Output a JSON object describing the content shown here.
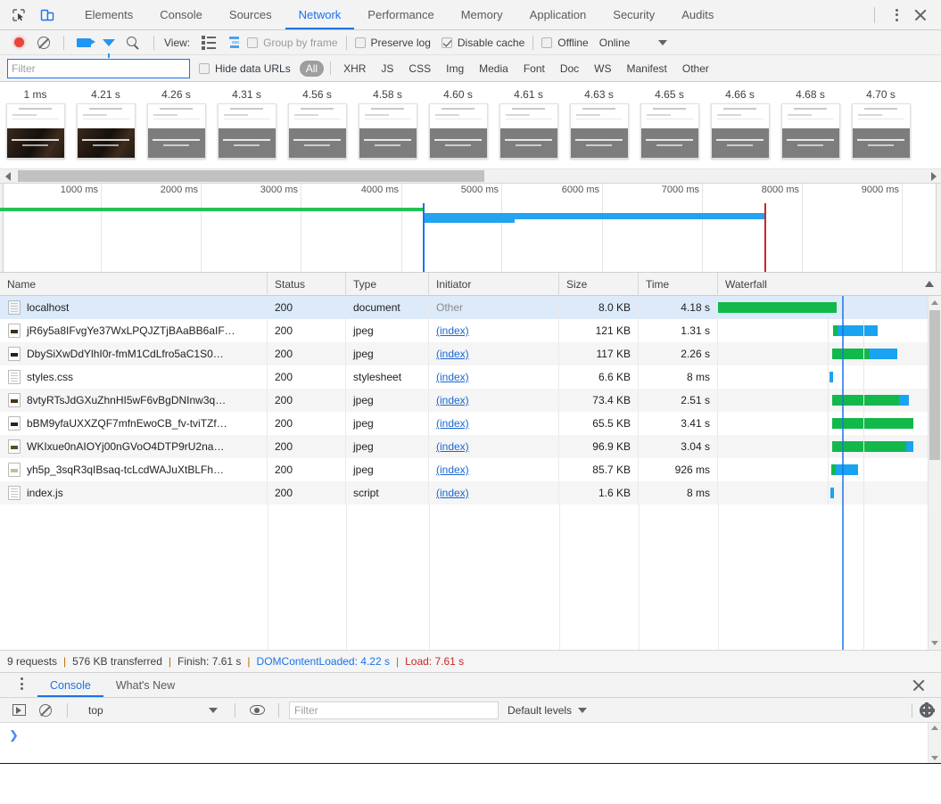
{
  "window": {
    "devtools_tabs": [
      {
        "label": "Elements",
        "active": false
      },
      {
        "label": "Console",
        "active": false
      },
      {
        "label": "Sources",
        "active": false
      },
      {
        "label": "Network",
        "active": true
      },
      {
        "label": "Performance",
        "active": false
      },
      {
        "label": "Memory",
        "active": false
      },
      {
        "label": "Application",
        "active": false
      },
      {
        "label": "Security",
        "active": false
      },
      {
        "label": "Audits",
        "active": false
      }
    ],
    "inspect_icon": "inspect-element-icon",
    "device_icon": "device-toolbar-icon",
    "more_icon": "more-options-icon",
    "close_icon": "close-icon",
    "accent_color": "#1a73e8"
  },
  "network_toolbar": {
    "record_icon": "record-button-icon",
    "clear_icon": "clear-icon",
    "camera_icon": "capture-screenshots-icon",
    "filter_icon": "filter-icon",
    "search_icon": "search-icon",
    "view_label": "View:",
    "view_list_icon": "list-view-icon",
    "view_waterfall_icon": "waterfall-view-icon",
    "group_by_frame": {
      "label": "Group by frame",
      "checked": false,
      "disabled": true
    },
    "preserve_log": {
      "label": "Preserve log",
      "checked": false
    },
    "disable_cache": {
      "label": "Disable cache",
      "checked": true
    },
    "offline": {
      "label": "Offline",
      "checked": false
    },
    "throttling": {
      "label": "Online",
      "caret_icon": "chevron-down-icon"
    }
  },
  "filter_bar": {
    "input_value": "",
    "input_placeholder": "Filter",
    "hide_data_urls": {
      "label": "Hide data URLs",
      "checked": false
    },
    "types": [
      {
        "label": "All",
        "active": true
      },
      {
        "label": "XHR",
        "active": false
      },
      {
        "label": "JS",
        "active": false
      },
      {
        "label": "CSS",
        "active": false
      },
      {
        "label": "Img",
        "active": false
      },
      {
        "label": "Media",
        "active": false
      },
      {
        "label": "Font",
        "active": false
      },
      {
        "label": "Doc",
        "active": false
      },
      {
        "label": "WS",
        "active": false
      },
      {
        "label": "Manifest",
        "active": false
      },
      {
        "label": "Other",
        "active": false
      }
    ]
  },
  "filmstrip": {
    "frames": [
      {
        "time": "1 ms",
        "style": "photo"
      },
      {
        "time": "4.21 s",
        "style": "photo"
      },
      {
        "time": "4.26 s",
        "style": "gray"
      },
      {
        "time": "4.31 s",
        "style": "gray"
      },
      {
        "time": "4.56 s",
        "style": "gray"
      },
      {
        "time": "4.58 s",
        "style": "gray"
      },
      {
        "time": "4.60 s",
        "style": "gray"
      },
      {
        "time": "4.61 s",
        "style": "gray"
      },
      {
        "time": "4.63 s",
        "style": "gray"
      },
      {
        "time": "4.65 s",
        "style": "gray"
      },
      {
        "time": "4.66 s",
        "style": "gray"
      },
      {
        "time": "4.68 s",
        "style": "gray"
      },
      {
        "time": "4.70 s",
        "style": "gray"
      }
    ],
    "scroll_left_icon": "scroll-left-arrow-icon",
    "scroll_right_icon": "scroll-right-arrow-icon"
  },
  "overview": {
    "ticks": [
      "1000 ms",
      "2000 ms",
      "3000 ms",
      "4000 ms",
      "5000 ms",
      "6000 ms",
      "7000 ms",
      "8000 ms",
      "9000 ms"
    ],
    "dom_content_loaded_marker": "4.22 s",
    "load_marker": "7.61 s"
  },
  "table": {
    "columns": [
      {
        "label": "Name"
      },
      {
        "label": "Status"
      },
      {
        "label": "Type"
      },
      {
        "label": "Initiator"
      },
      {
        "label": "Size"
      },
      {
        "label": "Time"
      },
      {
        "label": "Waterfall"
      }
    ],
    "sort_icon": "sort-ascending-icon",
    "rows": [
      {
        "name": "localhost",
        "status": "200",
        "type": "document",
        "initiator": "Other",
        "initiator_link": false,
        "size": "8.0 KB",
        "time": "4.18 s",
        "icon": "document-icon",
        "selected": true
      },
      {
        "name": "jR6y5a8IFvgYe37WxLPQJZTjBAaBB6aIF…",
        "status": "200",
        "type": "jpeg",
        "initiator": "(index)",
        "initiator_link": true,
        "size": "121 KB",
        "time": "1.31 s",
        "icon": "image-icon",
        "selected": false
      },
      {
        "name": "DbySiXwDdYlhI0r-fmM1CdLfro5aC1S0…",
        "status": "200",
        "type": "jpeg",
        "initiator": "(index)",
        "initiator_link": true,
        "size": "117 KB",
        "time": "2.26 s",
        "icon": "image-icon",
        "selected": false
      },
      {
        "name": "styles.css",
        "status": "200",
        "type": "stylesheet",
        "initiator": "(index)",
        "initiator_link": true,
        "size": "6.6 KB",
        "time": "8 ms",
        "icon": "stylesheet-icon",
        "selected": false
      },
      {
        "name": "8vtyRTsJdGXuZhnHI5wF6vBgDNInw3q…",
        "status": "200",
        "type": "jpeg",
        "initiator": "(index)",
        "initiator_link": true,
        "size": "73.4 KB",
        "time": "2.51 s",
        "icon": "image-icon",
        "selected": false
      },
      {
        "name": "bBM9yfaUXXZQF7mfnEwoCB_fv-tviTZf…",
        "status": "200",
        "type": "jpeg",
        "initiator": "(index)",
        "initiator_link": true,
        "size": "65.5 KB",
        "time": "3.41 s",
        "icon": "image-icon",
        "selected": false
      },
      {
        "name": "WKIxue0nAIOYj00nGVoO4DTP9rU2na…",
        "status": "200",
        "type": "jpeg",
        "initiator": "(index)",
        "initiator_link": true,
        "size": "96.9 KB",
        "time": "3.04 s",
        "icon": "image-icon",
        "selected": false
      },
      {
        "name": "yh5p_3sqR3qIBsaq-tcLcdWAJuXtBLFh…",
        "status": "200",
        "type": "jpeg",
        "initiator": "(index)",
        "initiator_link": true,
        "size": "85.7 KB",
        "time": "926 ms",
        "icon": "image-icon",
        "selected": false
      },
      {
        "name": "index.js",
        "status": "200",
        "type": "script",
        "initiator": "(index)",
        "initiator_link": true,
        "size": "1.6 KB",
        "time": "8 ms",
        "icon": "script-icon",
        "selected": false
      }
    ]
  },
  "status_bar": {
    "requests": "9 requests",
    "transferred": "576 KB transferred",
    "finish": "Finish: 7.61 s",
    "dom_content_loaded": "DOMContentLoaded: 4.22 s",
    "load": "Load: 7.61 s",
    "separator": "|",
    "dcl_color": "#1a73e8",
    "load_color": "#c62828"
  },
  "drawer": {
    "more_icon": "more-options-icon",
    "tabs": [
      {
        "label": "Console",
        "active": true
      },
      {
        "label": "What's New",
        "active": false
      }
    ],
    "close_icon": "close-drawer-icon",
    "toolbar": {
      "execute_icon": "execution-context-icon",
      "clear_icon": "clear-console-icon",
      "context_value": "top",
      "context_caret_icon": "chevron-down-icon",
      "eye_icon": "live-expression-icon",
      "filter_value": "",
      "filter_placeholder": "Filter",
      "levels_label": "Default levels",
      "levels_caret_icon": "chevron-down-icon",
      "settings_icon": "gear-icon"
    },
    "prompt_symbol": "❯"
  }
}
